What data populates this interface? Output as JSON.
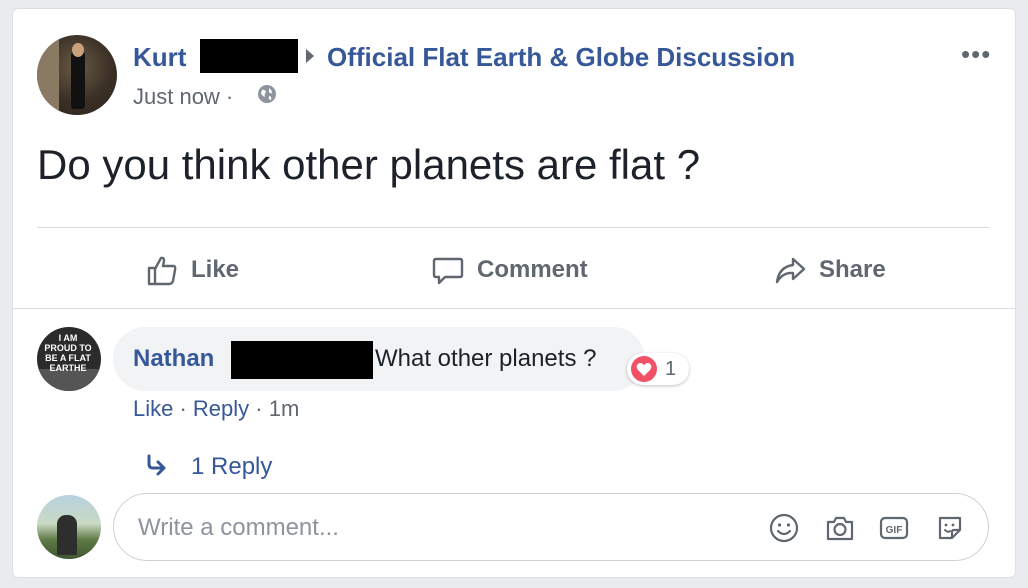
{
  "post": {
    "author": "Kurt",
    "group": "Official Flat Earth & Globe Discussion",
    "timestamp": "Just now ·",
    "text": "Do you think other planets are flat ?",
    "more_icon": "more-options-icon"
  },
  "actions": {
    "like": "Like",
    "comment": "Comment",
    "share": "Share"
  },
  "comment": {
    "author": "Nathan",
    "text": "What other planets ?",
    "avatar_sign": "I AM PROUD TO BE A FLAT EARTHE",
    "reaction": "heart",
    "reaction_count": "1",
    "like": "Like",
    "sep1": " · ",
    "reply": "Reply",
    "sep2": " · ",
    "time": "1m",
    "replies": "1 Reply"
  },
  "composer": {
    "placeholder": "Write a comment...",
    "icons": [
      "emoji-icon",
      "camera-icon",
      "gif-icon",
      "sticker-icon"
    ]
  },
  "colors": {
    "link": "#365899",
    "secondary": "#606770",
    "heart": "#f25268"
  }
}
